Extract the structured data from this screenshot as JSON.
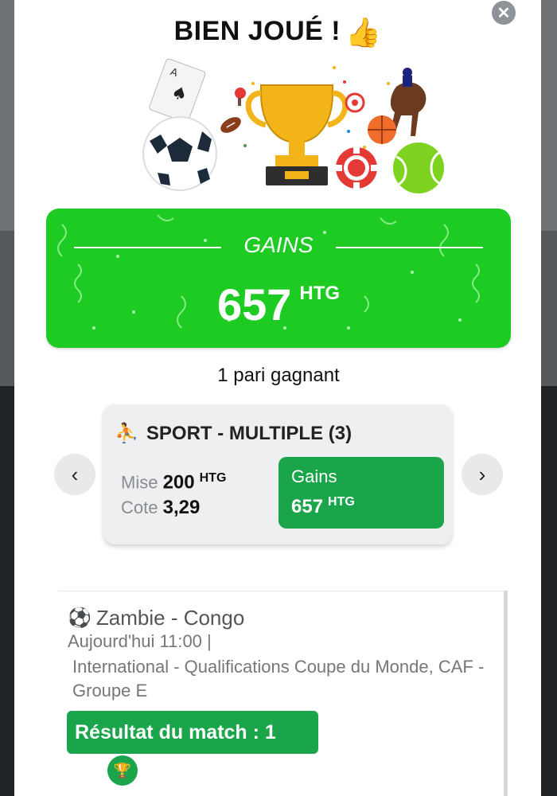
{
  "modal": {
    "title": "BIEN JOUÉ !",
    "close_icon": "close-icon",
    "thumbs_icon": "thumbs-up-icon"
  },
  "gains_banner": {
    "label": "GAINS",
    "amount": "657",
    "currency": "HTG",
    "color": "#1ecb23"
  },
  "summary": {
    "winning_bets": "1 pari gagnant"
  },
  "bet_card": {
    "heading": "SPORT - MULTIPLE (3)",
    "stake_label": "Mise",
    "stake_value": "200",
    "stake_currency": "HTG",
    "odds_label": "Cote",
    "odds_value": "3,29",
    "winnings_label": "Gains",
    "winnings_value": "657",
    "winnings_currency": "HTG",
    "accent": "#1aa54a"
  },
  "nav": {
    "prev_icon": "chevron-left-icon",
    "next_icon": "chevron-right-icon"
  },
  "event": {
    "match": "Zambie - Congo",
    "datetime": "Aujourd'hui 11:00 |",
    "competition": "International  -  Qualifications Coupe du Monde, CAF  -  Groupe E",
    "result": "Résultat du match : 1"
  }
}
